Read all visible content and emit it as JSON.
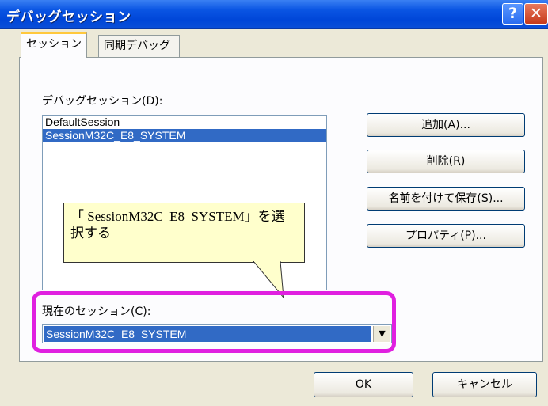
{
  "window": {
    "title": "デバッグセッション",
    "help_glyph": "?",
    "close_glyph": "✕"
  },
  "tabs": [
    {
      "label": "セッション",
      "active": true
    },
    {
      "label": "同期デバッグ",
      "active": false
    }
  ],
  "sessions": {
    "label": "デバッグセッション(D):",
    "items": [
      {
        "label": "DefaultSession",
        "selected": false
      },
      {
        "label": "SessionM32C_E8_SYSTEM",
        "selected": true
      }
    ]
  },
  "buttons": {
    "add": "追加(A)...",
    "delete": "削除(R)",
    "save_as": "名前を付けて保存(S)...",
    "properties": "プロパティ(P)..."
  },
  "callout": {
    "text": "「 SessionM32C_E8_SYSTEM」を選択する"
  },
  "current_session": {
    "label": "現在のセッション(C):",
    "value": "SessionM32C_E8_SYSTEM"
  },
  "footer": {
    "ok": "OK",
    "cancel": "キャンセル"
  },
  "colors": {
    "selection": "#316ac5",
    "highlight": "#e020e0",
    "callout_bg": "#ffffcc",
    "titlebar": "#0a55e3"
  }
}
